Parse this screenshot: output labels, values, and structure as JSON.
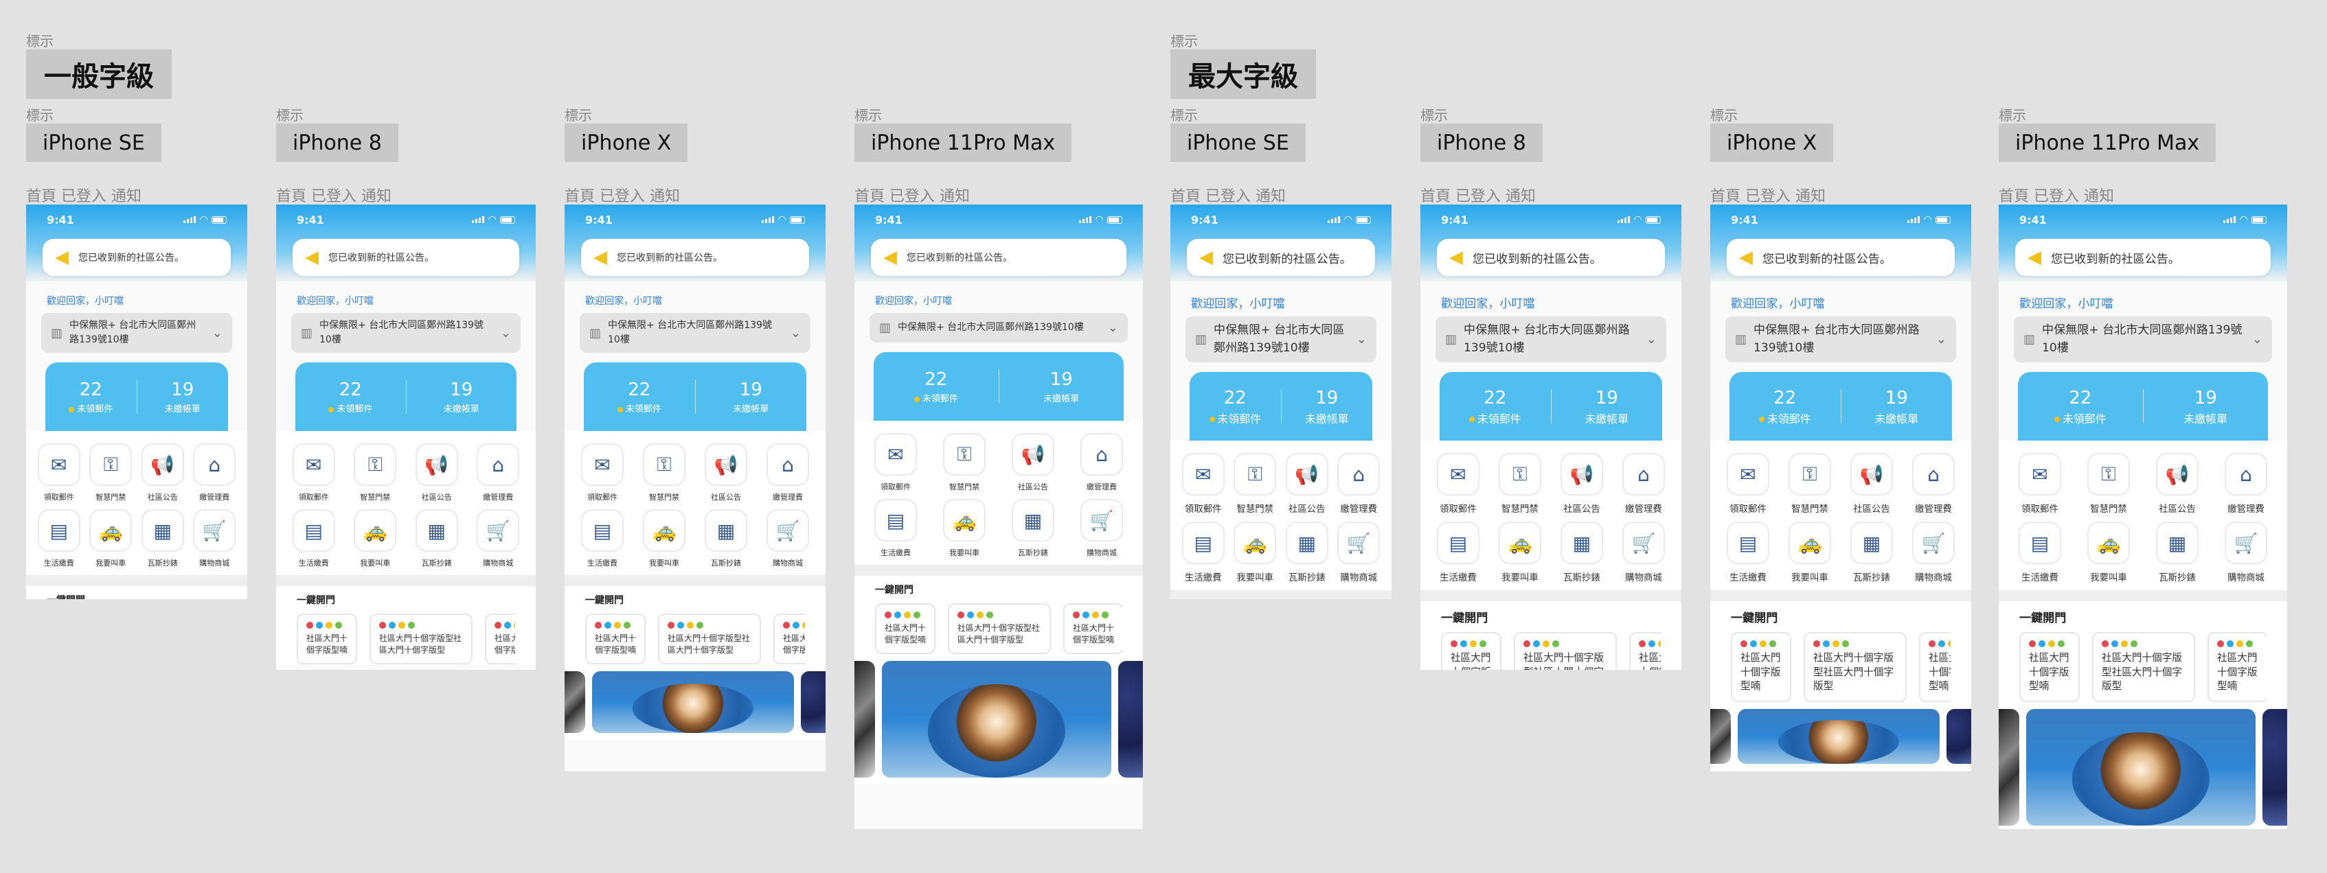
{
  "groups": [
    {
      "label_small": "標示",
      "title": "一般字級"
    },
    {
      "label_small": "標示",
      "title": "最大字級"
    }
  ],
  "devices": [
    {
      "label_small": "標示",
      "name": "iPhone SE"
    },
    {
      "label_small": "標示",
      "name": "iPhone 8"
    },
    {
      "label_small": "標示",
      "name": "iPhone X"
    },
    {
      "label_small": "標示",
      "name": "iPhone 11Pro Max"
    },
    {
      "label_small": "標示",
      "name": "iPhone SE"
    },
    {
      "label_small": "標示",
      "name": "iPhone 8"
    },
    {
      "label_small": "標示",
      "name": "iPhone X"
    },
    {
      "label_small": "標示",
      "name": "iPhone 11Pro Max"
    }
  ],
  "frame_title": "首頁 已登入 通知",
  "app": {
    "time": "9:41",
    "notice": "您已收到新的社區公告。",
    "welcome": "歡迎回家，小叮噹",
    "address": "中保無限+ 台北市大同區鄭州路139號10樓",
    "stats": [
      {
        "value": "22",
        "label": "未領郵件"
      },
      {
        "value": "19",
        "label": "未繳帳單"
      }
    ],
    "services": [
      {
        "label": "領取郵件",
        "icon": "mail-icon",
        "glyph": "✉"
      },
      {
        "label": "智慧門禁",
        "icon": "key-icon",
        "glyph": "⚿"
      },
      {
        "label": "社區公告",
        "icon": "megaphone-icon",
        "glyph": "📢"
      },
      {
        "label": "繳管理費",
        "icon": "house-icon",
        "glyph": "⌂"
      },
      {
        "label": "生活繳費",
        "icon": "bill-icon",
        "glyph": "▤"
      },
      {
        "label": "我要叫車",
        "icon": "taxi-icon",
        "glyph": "🚕"
      },
      {
        "label": "瓦斯抄錶",
        "icon": "meter-icon",
        "glyph": "▦"
      },
      {
        "label": "購物商城",
        "icon": "cart-icon",
        "glyph": "🛒"
      }
    ],
    "quick_title": "一鍵開門",
    "quick_cards": [
      "社區大門十個字版型喃",
      "社區大門十個字版型社區大門十個字版型",
      "社區大門十個字版型喃"
    ]
  },
  "colors": {
    "header": "#2aa6ea",
    "stats_bg": "#50bfef",
    "accent_yellow": "#f2c21b",
    "link_blue": "#2f7fd6"
  }
}
